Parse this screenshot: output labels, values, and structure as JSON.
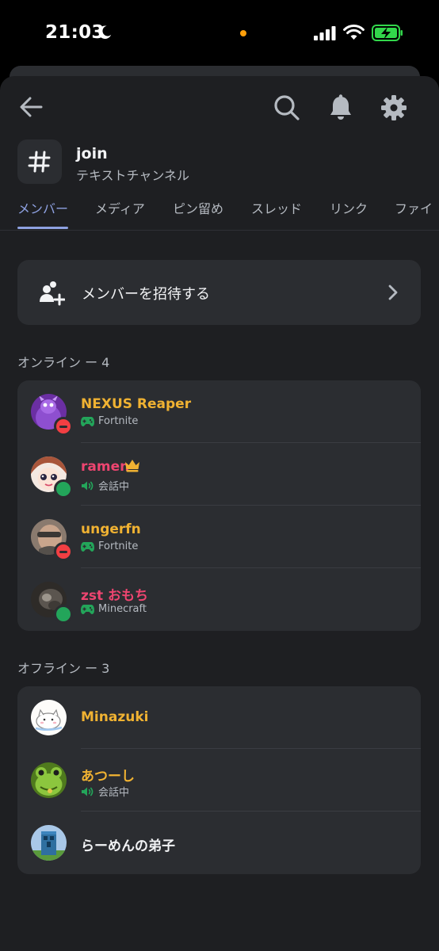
{
  "status_bar": {
    "time": "21:03"
  },
  "channel": {
    "name": "join",
    "type": "テキストチャンネル"
  },
  "tabs": [
    {
      "label": "メンバー",
      "active": true
    },
    {
      "label": "メディア",
      "active": false
    },
    {
      "label": "ピン留め",
      "active": false
    },
    {
      "label": "スレッド",
      "active": false
    },
    {
      "label": "リンク",
      "active": false
    },
    {
      "label": "ファイ",
      "active": false
    }
  ],
  "invite": {
    "label": "メンバーを招待する"
  },
  "online": {
    "header": "オンライン ー 4",
    "members": [
      {
        "name": "NEXUS Reaper",
        "name_color": "#f0b232",
        "status": "dnd",
        "activity_icon": "gamepad-icon",
        "activity": "Fortnite",
        "avatar": "purple-dragon"
      },
      {
        "name": "ramen",
        "name_color": "#ee4570",
        "status": "online",
        "activity_icon": "speaker-icon",
        "activity": "会話中",
        "crown": true,
        "avatar": "anime-girl"
      },
      {
        "name": "ungerfn",
        "name_color": "#f0b232",
        "status": "dnd",
        "activity_icon": "gamepad-icon",
        "activity": "Fortnite",
        "avatar": "photo-person"
      },
      {
        "name": "zst おもち",
        "name_color": "#ee4570",
        "status": "online",
        "activity_icon": "gamepad-icon",
        "activity": "Minecraft",
        "avatar": "dark-cat"
      }
    ]
  },
  "offline": {
    "header": "オフライン ー 3",
    "members": [
      {
        "name": "Minazuki",
        "name_color": "#f0b232",
        "avatar": "white-cat"
      },
      {
        "name": "あつーし",
        "name_color": "#f0b232",
        "activity_icon": "speaker-icon",
        "activity": "会話中",
        "avatar": "green-frog"
      },
      {
        "name": "らーめんの弟子",
        "name_color": "#f2f3f5",
        "avatar": "pixel-creeper"
      }
    ]
  },
  "colors": {
    "background": "#1e1f22",
    "card": "#2b2d31",
    "accent": "#8ea1e1",
    "online": "#23a55a",
    "dnd": "#f23f43",
    "crown": "#f0b232"
  }
}
